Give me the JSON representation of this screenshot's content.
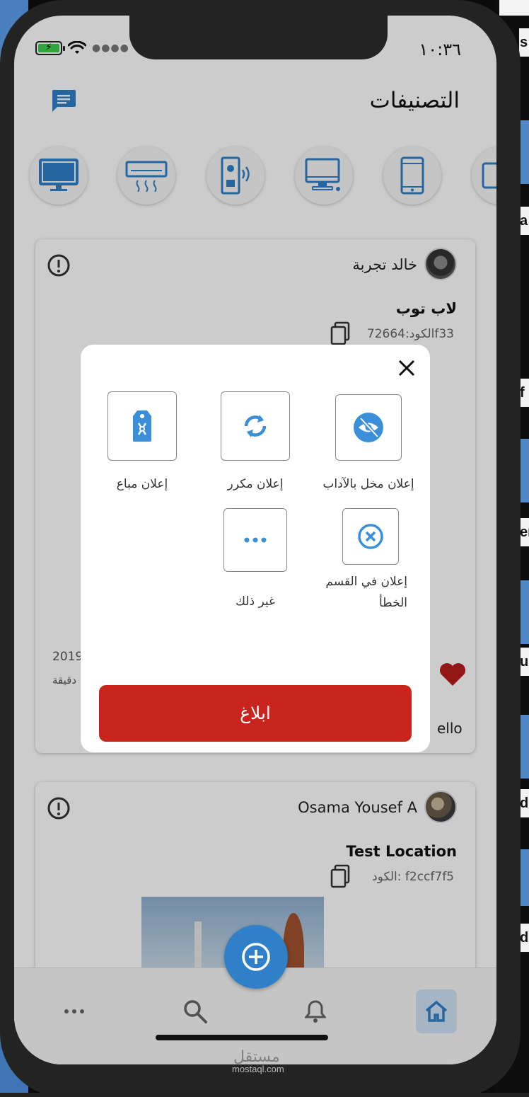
{
  "status": {
    "time": "١٠:٣٦"
  },
  "header": {
    "title": "التصنيفات"
  },
  "categories": [
    "tv-icon",
    "air-conditioner-icon",
    "speaker-icon",
    "desktop-computer-icon",
    "mobile-phone-icon",
    "tablet-icon"
  ],
  "posts": [
    {
      "user": "خالد تجربة",
      "title": "لاب توب",
      "code": "الكود:72664f33",
      "date_partial": "2019",
      "time_partial": "دقيقة",
      "comment_partial": "ello"
    },
    {
      "user": "Osama Yousef A",
      "title": "Test Location",
      "code": "الكود:  f2ccf7f5"
    }
  ],
  "report_modal": {
    "options": [
      {
        "label": "إعلان مخل بالآداب",
        "icon": "hidden-eye-icon"
      },
      {
        "label": "إعلان مكرر",
        "icon": "refresh-icon"
      },
      {
        "label": "إعلان مباع",
        "icon": "sold-tag-icon"
      },
      {
        "label_line1": "إعلان في القسم",
        "label_line2": "الخطأ",
        "icon": "close-circle-icon"
      },
      {
        "label": "غير ذلك",
        "icon": "more-dots-icon"
      }
    ],
    "submit_label": "ابلاغ"
  },
  "watermark": "mostaql.com",
  "bg_fragments": [
    "s",
    "a",
    "f",
    "er",
    "u",
    "d",
    "d"
  ],
  "colors": {
    "accent": "#2f80c8",
    "danger": "#c8231d",
    "heart": "#b71c1c"
  }
}
